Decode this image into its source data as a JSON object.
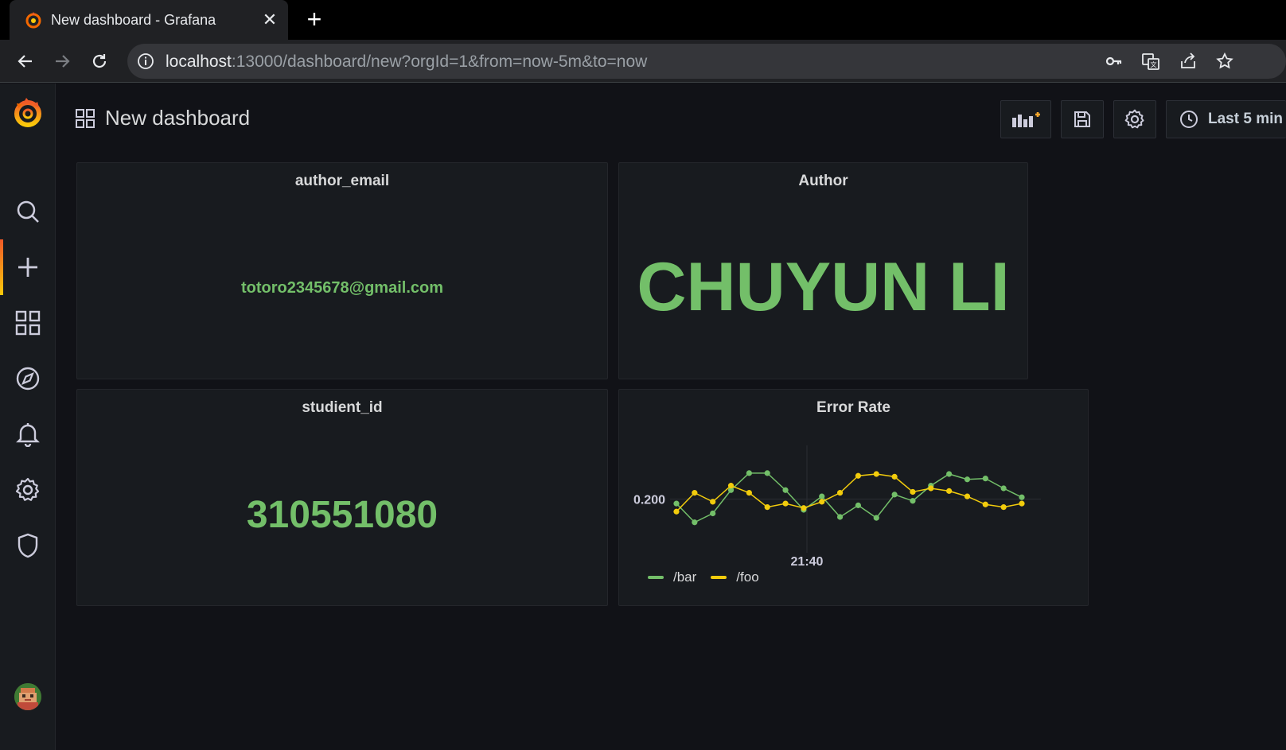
{
  "browser": {
    "tab_title": "New dashboard - Grafana",
    "url_host": "localhost",
    "url_rest": ":13000/dashboard/new?orgId=1&from=now-5m&to=now"
  },
  "sidebar": {
    "items": [
      {
        "icon": "search-icon"
      },
      {
        "icon": "plus-icon",
        "active": true
      },
      {
        "icon": "dashboards-icon"
      },
      {
        "icon": "explore-icon"
      },
      {
        "icon": "bell-icon"
      },
      {
        "icon": "gear-icon"
      },
      {
        "icon": "shield-icon"
      }
    ]
  },
  "dashboard": {
    "title": "New dashboard",
    "time_range": "Last 5 min"
  },
  "panels": {
    "author_email": {
      "title": "author_email",
      "value": "totoro2345678@gmail.com"
    },
    "author": {
      "title": "Author",
      "value": "CHUYUN LI"
    },
    "student_id": {
      "title": "studient_id",
      "value": "310551080"
    },
    "error_rate": {
      "title": "Error Rate"
    }
  },
  "colors": {
    "green": "#73bf69",
    "yellow": "#f2cc0c",
    "brand_orange": "#f05a28"
  },
  "chart_data": {
    "type": "line",
    "title": "Error Rate",
    "y_tick": "0.200",
    "x_tick": "21:40",
    "x": [
      0,
      1,
      2,
      3,
      4,
      5,
      6,
      7,
      8,
      9,
      10,
      11,
      12,
      13,
      14,
      15,
      16,
      17,
      18,
      19
    ],
    "ylim": [
      0.14,
      0.26
    ],
    "series": [
      {
        "name": "/bar",
        "color": "#73bf69",
        "values": [
          0.195,
          0.174,
          0.184,
          0.21,
          0.229,
          0.229,
          0.21,
          0.188,
          0.203,
          0.18,
          0.193,
          0.179,
          0.205,
          0.198,
          0.215,
          0.228,
          0.222,
          0.223,
          0.212,
          0.202
        ]
      },
      {
        "name": "/foo",
        "color": "#f2cc0c",
        "values": [
          0.186,
          0.207,
          0.197,
          0.215,
          0.207,
          0.191,
          0.195,
          0.19,
          0.197,
          0.207,
          0.226,
          0.228,
          0.225,
          0.208,
          0.212,
          0.209,
          0.203,
          0.194,
          0.191,
          0.195
        ]
      }
    ]
  }
}
